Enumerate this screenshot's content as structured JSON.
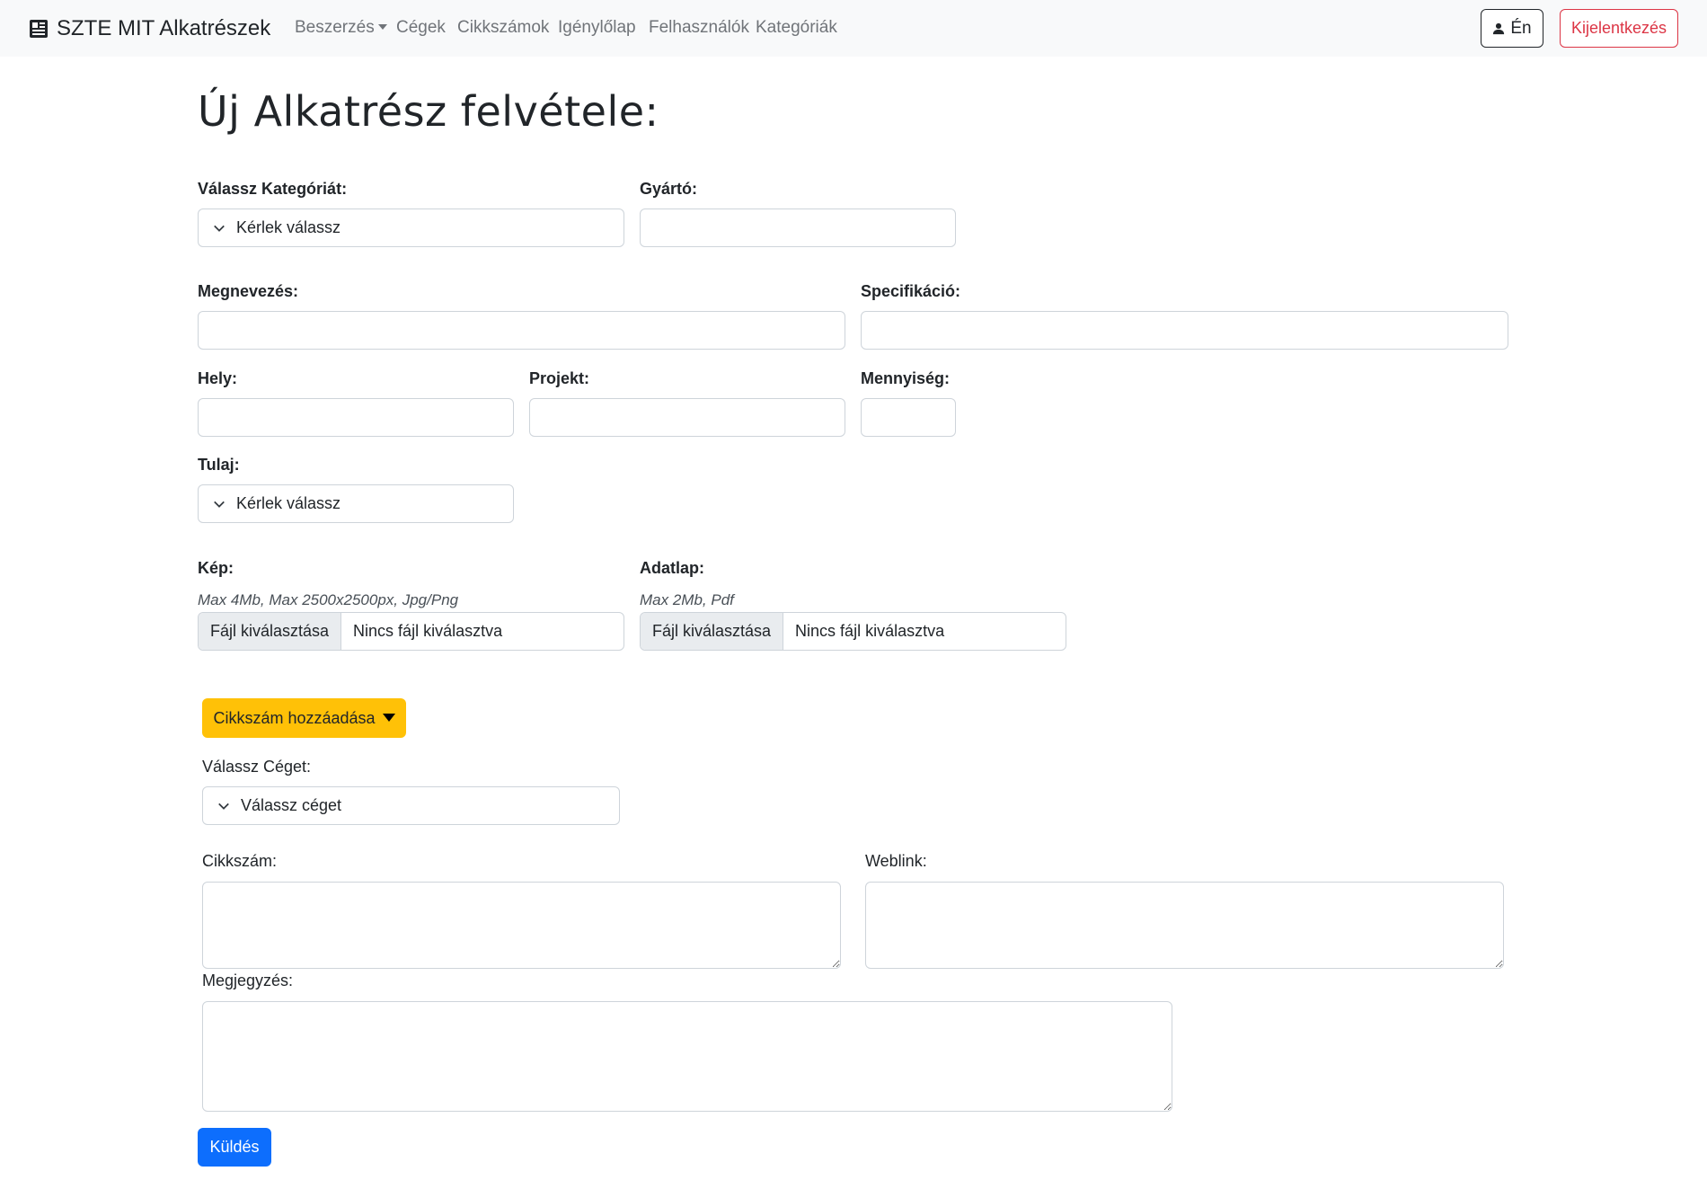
{
  "navbar": {
    "brand": "SZTE MIT Alkatrészek",
    "links": [
      "Beszerzés",
      "Cégek",
      "Cikkszámok",
      "Igénylőlap",
      "Felhasználók",
      "Kategóriák"
    ],
    "me_label": "Én",
    "logout_label": "Kijelentkezés"
  },
  "form": {
    "title": "Új Alkatrész felvétele:",
    "category_label": "Válassz Kategóriát:",
    "category_selected": "Kérlek válassz",
    "manufacturer_label": "Gyártó:",
    "name_label": "Megnevezés:",
    "spec_label": "Specifikáció:",
    "location_label": "Hely:",
    "project_label": "Projekt:",
    "quantity_label": "Mennyiség:",
    "owner_label": "Tulaj:",
    "owner_selected": "Kérlek válassz",
    "image_label": "Kép:",
    "image_hint": "Max 4Mb, Max 2500x2500px, Jpg/Png",
    "datasheet_label": "Adatlap:",
    "datasheet_hint": "Max 2Mb, Pdf",
    "file_button": "Fájl kiválasztása",
    "file_none": "Nincs fájl kiválasztva"
  },
  "article": {
    "add_button": "Cikkszám hozzáadása",
    "company_label": "Válassz Céget:",
    "company_selected": "Válassz céget",
    "article_label": "Cikkszám:",
    "weblink_label": "Weblink:",
    "note_label": "Megjegyzés:",
    "submit_label": "Küldés"
  },
  "colors": {
    "navbar_bg": "#f8f9fa",
    "warning": "#ffc107",
    "primary": "#0d6efd",
    "danger": "#dc3545"
  }
}
